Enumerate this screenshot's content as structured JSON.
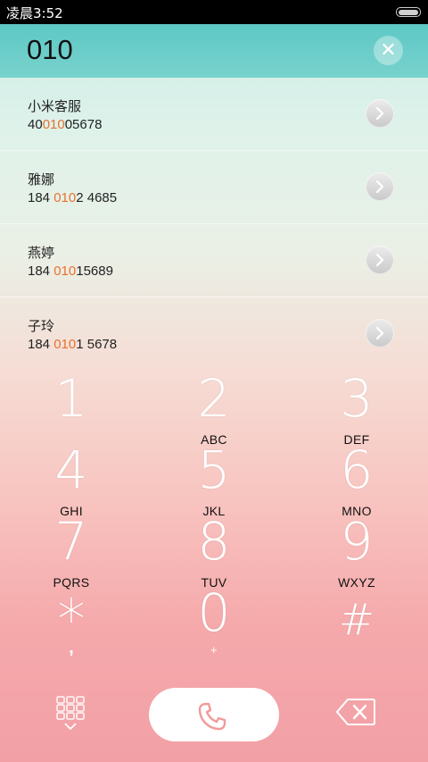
{
  "status_bar": {
    "time": "凌晨3:52"
  },
  "header": {
    "query": "010",
    "clear_icon": "✕"
  },
  "contacts": [
    {
      "name": "小米客服",
      "number_pre": "40",
      "number_match": "010",
      "number_post": "05678"
    },
    {
      "name": "雅娜",
      "number_pre": "184 ",
      "number_match": "010",
      "number_post": "2 4685"
    },
    {
      "name": "燕婷",
      "number_pre": "184 ",
      "number_match": "010",
      "number_post": "15689"
    },
    {
      "name": "子玲",
      "number_pre": "184 ",
      "number_match": "010",
      "number_post": "1 5678"
    }
  ],
  "keypad": [
    {
      "digit": "1",
      "letters": ""
    },
    {
      "digit": "2",
      "letters": "ABC"
    },
    {
      "digit": "3",
      "letters": "DEF"
    },
    {
      "digit": "4",
      "letters": "GHI"
    },
    {
      "digit": "5",
      "letters": "JKL"
    },
    {
      "digit": "6",
      "letters": "MNO"
    },
    {
      "digit": "7",
      "letters": "PQRS"
    },
    {
      "digit": "8",
      "letters": "TUV"
    },
    {
      "digit": "9",
      "letters": "WXYZ"
    },
    {
      "digit": "*",
      "letters": ","
    },
    {
      "digit": "0",
      "letters": "+"
    },
    {
      "digit": "#",
      "letters": ""
    }
  ],
  "icons": {
    "keypad_toggle": "keypad-grid-icon",
    "call": "phone-icon",
    "delete": "backspace-icon",
    "contact_arrow": "chevron-right-icon"
  },
  "colors": {
    "header": "#5ec8c6",
    "match_highlight": "#e8722e",
    "call_icon": "#f29a9a"
  }
}
